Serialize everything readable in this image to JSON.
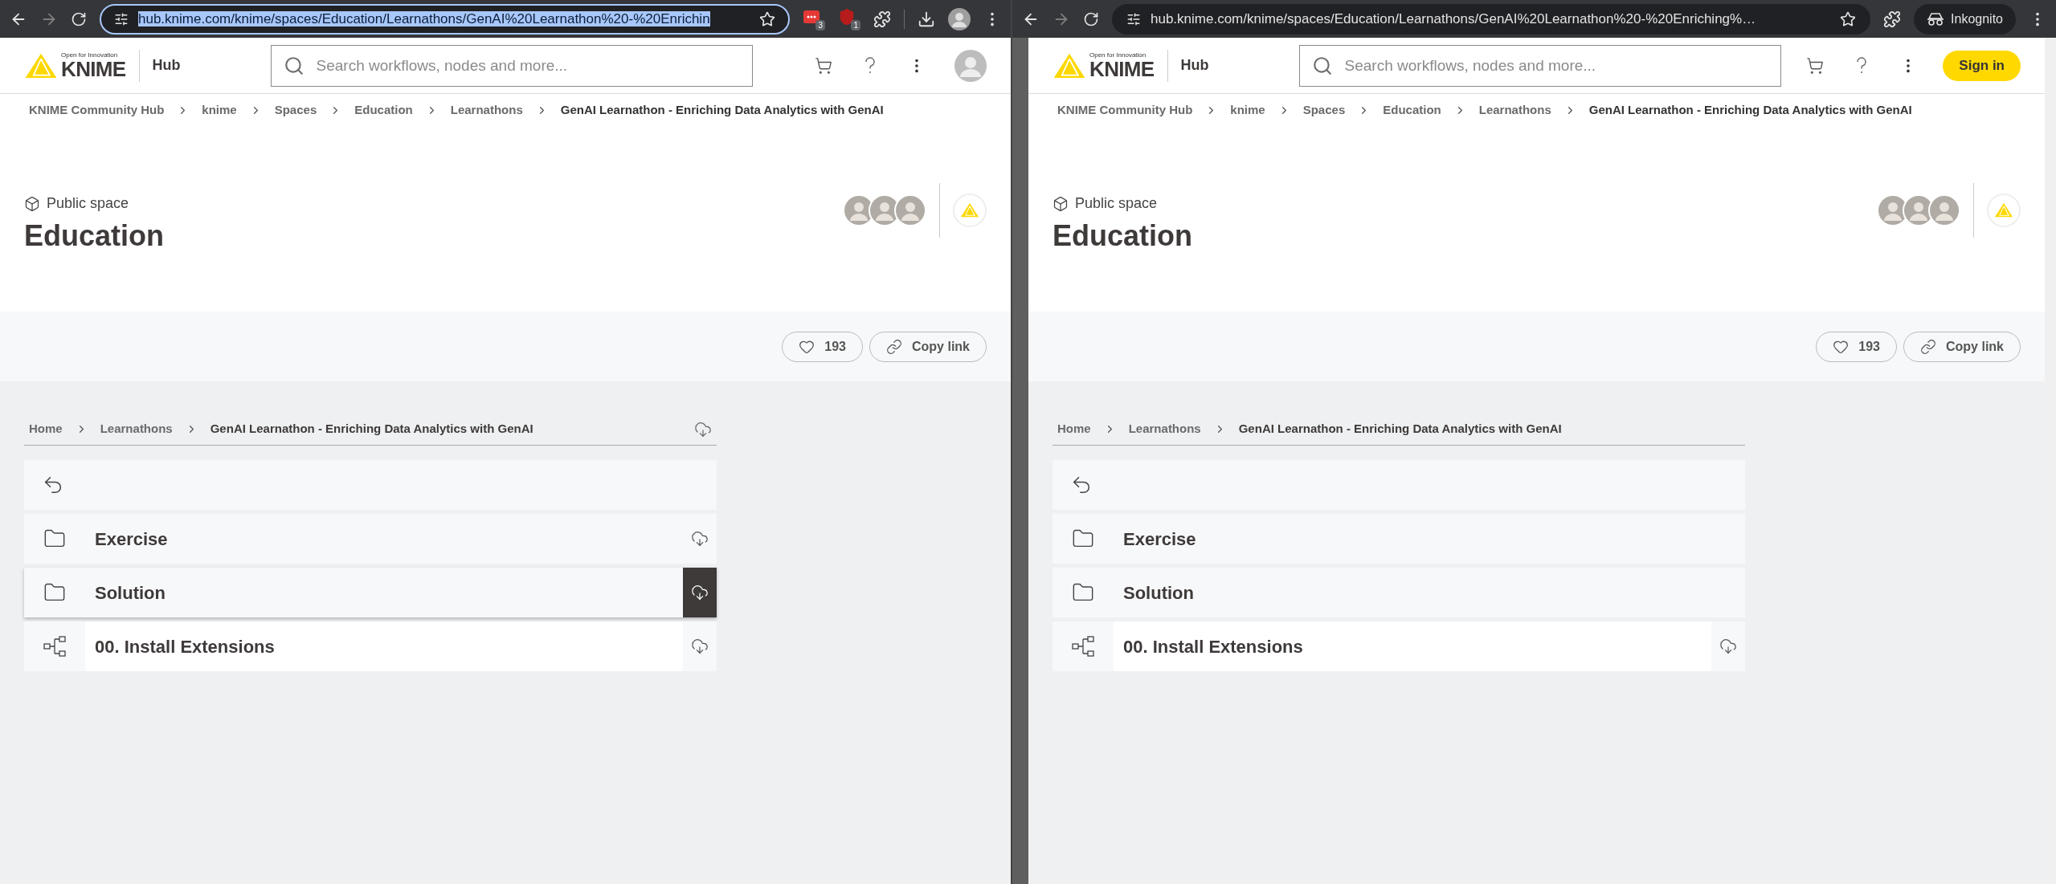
{
  "windows": [
    {
      "toolbar": {
        "url": "hub.knime.com/knime/spaces/Education/Learnathons/GenAI%20Learnathon%20-%20Enrichin",
        "url_selected": true,
        "extensions": [
          {
            "kind": "dots",
            "badge": "3"
          },
          {
            "kind": "shield",
            "badge": "1"
          }
        ],
        "download_button": true,
        "profile": {
          "kind": "avatar"
        }
      },
      "header": {
        "logo_tagline": "Open for Innovation",
        "logo_wordmark": "KNIME",
        "hub_label": "Hub",
        "search_placeholder": "Search workflows, nodes and more...",
        "account": {
          "kind": "avatar"
        }
      },
      "breadcrumbs": [
        "KNIME Community Hub",
        "knime",
        "Spaces",
        "Education",
        "Learnathons",
        "GenAI Learnathon - Enriching Data Analytics with GenAI"
      ],
      "space": {
        "type_label": "Public space",
        "title": "Education",
        "likes": "193",
        "copy_link": "Copy link"
      },
      "explorer": {
        "breadcrumbs": [
          "Home",
          "Learnathons",
          "GenAI Learnathon - Enriching Data Analytics with GenAI"
        ],
        "download_all": true,
        "items": [
          {
            "kind": "folder",
            "name": "Exercise",
            "download_icon": true,
            "hovered": false
          },
          {
            "kind": "folder",
            "name": "Solution",
            "download_icon": true,
            "hovered": true
          },
          {
            "kind": "workflow",
            "name": "00. Install Extensions",
            "download_icon": true,
            "hovered": false
          }
        ]
      }
    },
    {
      "toolbar": {
        "url": "hub.knime.com/knime/spaces/Education/Learnathons/GenAI%20Learnathon%20-%20Enriching%…",
        "url_selected": false,
        "download_button": false,
        "profile": {
          "kind": "incognito",
          "label": "Inkognito"
        }
      },
      "header": {
        "logo_tagline": "Open for Innovation",
        "logo_wordmark": "KNIME",
        "hub_label": "Hub",
        "search_placeholder": "Search workflows, nodes and more...",
        "account": {
          "kind": "button",
          "label": "Sign in"
        }
      },
      "breadcrumbs": [
        "KNIME Community Hub",
        "knime",
        "Spaces",
        "Education",
        "Learnathons",
        "GenAI Learnathon - Enriching Data Analytics with GenAI"
      ],
      "space": {
        "type_label": "Public space",
        "title": "Education",
        "likes": "193",
        "copy_link": "Copy link"
      },
      "explorer": {
        "breadcrumbs": [
          "Home",
          "Learnathons",
          "GenAI Learnathon - Enriching Data Analytics with GenAI"
        ],
        "download_all": false,
        "items": [
          {
            "kind": "folder",
            "name": "Exercise",
            "download_icon": false,
            "hovered": false
          },
          {
            "kind": "folder",
            "name": "Solution",
            "download_icon": false,
            "hovered": false
          },
          {
            "kind": "workflow",
            "name": "00. Install Extensions",
            "download_icon": true,
            "hovered": false
          }
        ]
      }
    }
  ]
}
